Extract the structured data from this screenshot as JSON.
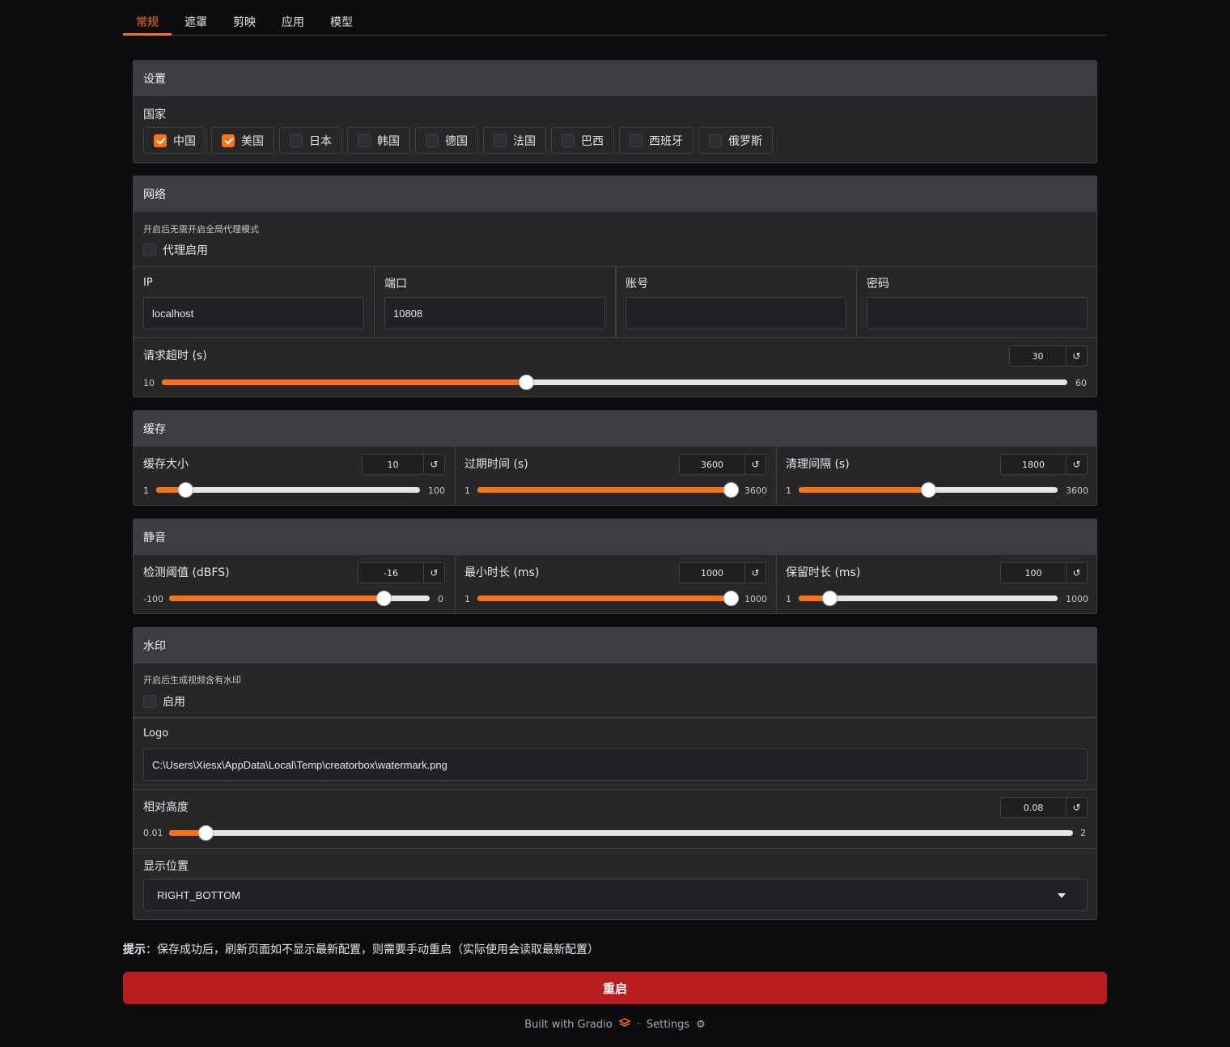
{
  "tabs": [
    {
      "label": "常规",
      "active": true
    },
    {
      "label": "遮罩",
      "active": false
    },
    {
      "label": "剪映",
      "active": false
    },
    {
      "label": "应用",
      "active": false
    },
    {
      "label": "模型",
      "active": false
    }
  ],
  "settings": {
    "title": "设置",
    "country_label": "国家",
    "countries": [
      {
        "label": "中国",
        "checked": true
      },
      {
        "label": "美国",
        "checked": true
      },
      {
        "label": "日本",
        "checked": false
      },
      {
        "label": "韩国",
        "checked": false
      },
      {
        "label": "德国",
        "checked": false
      },
      {
        "label": "法国",
        "checked": false
      },
      {
        "label": "巴西",
        "checked": false
      },
      {
        "label": "西班牙",
        "checked": false
      },
      {
        "label": "俄罗斯",
        "checked": false
      }
    ]
  },
  "network": {
    "title": "网络",
    "proxy_info": "开启后无需开启全局代理模式",
    "proxy_label": "代理启用",
    "proxy_checked": false,
    "ip_label": "IP",
    "ip_value": "localhost",
    "port_label": "端口",
    "port_value": "10808",
    "account_label": "账号",
    "account_value": "",
    "password_label": "密码",
    "password_value": "",
    "timeout": {
      "label": "请求超时 (s)",
      "value": "30",
      "min": "10",
      "max": "60"
    }
  },
  "cache": {
    "title": "缓存",
    "sliders": [
      {
        "label": "缓存大小",
        "value": "10",
        "min": "1",
        "max": "100"
      },
      {
        "label": "过期时间 (s)",
        "value": "3600",
        "min": "1",
        "max": "3600"
      },
      {
        "label": "清理间隔 (s)",
        "value": "1800",
        "min": "1",
        "max": "3600"
      }
    ]
  },
  "mute": {
    "title": "静音",
    "sliders": [
      {
        "label": "检测阈值 (dBFS)",
        "value": "-16",
        "min": "-100",
        "max": "0"
      },
      {
        "label": "最小时长 (ms)",
        "value": "1000",
        "min": "1",
        "max": "1000"
      },
      {
        "label": "保留时长 (ms)",
        "value": "100",
        "min": "1",
        "max": "1000"
      }
    ]
  },
  "watermark": {
    "title": "水印",
    "enable_info": "开启后生成视频含有水印",
    "enable_label": "启用",
    "enable_checked": false,
    "logo_label": "Logo",
    "logo_value": "C:\\Users\\Xiesx\\AppData\\Local\\Temp\\creatorbox\\watermark.png",
    "height": {
      "label": "相对高度",
      "value": "0.08",
      "min": "0.01",
      "max": "2"
    },
    "position_label": "显示位置",
    "position_value": "RIGHT_BOTTOM"
  },
  "hint": {
    "bold": "提示",
    "text": "：保存成功后，刷新页面如不显示最新配置，则需要手动重启（实际使用会读取最新配置）"
  },
  "restart_label": "重启",
  "footer": {
    "built_with": "Built with Gradio",
    "separator": "·",
    "settings": "Settings"
  },
  "colors": {
    "accent": "#f97316",
    "restart": "#b91c1c",
    "background": "#0c0c0f",
    "panel": "#27272a"
  }
}
